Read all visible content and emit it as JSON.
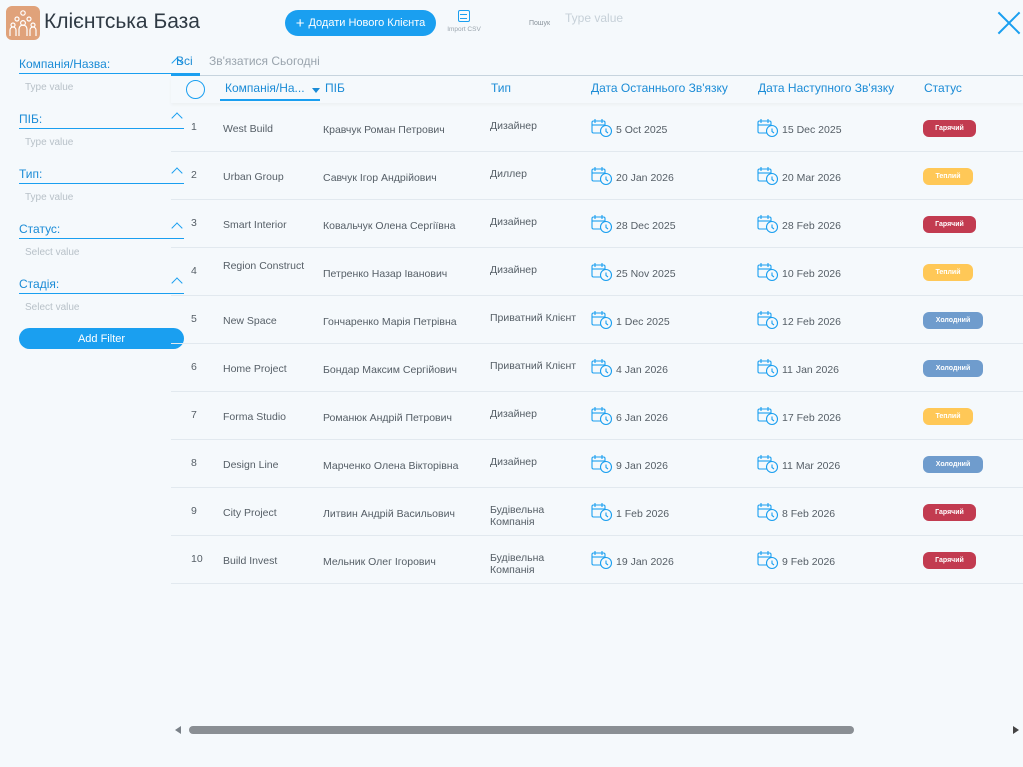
{
  "app": {
    "title": "Клієнтська База"
  },
  "toolbar": {
    "add_label": "Додати Нового Клієнта",
    "import_label": "Import CSV",
    "search_label": "Пошук",
    "search_placeholder": "Type value"
  },
  "filters": [
    {
      "label": "Компанія/Назва:",
      "placeholder": "Type value"
    },
    {
      "label": "ПІБ:",
      "placeholder": "Type value"
    },
    {
      "label": "Тип:",
      "placeholder": "Type value"
    },
    {
      "label": "Статус:",
      "placeholder": "Select value"
    },
    {
      "label": "Стадія:",
      "placeholder": "Select value"
    }
  ],
  "add_filter_label": "Add Filter",
  "tabs": {
    "all": "Всі",
    "today": "Зв'язатися Сьогодні"
  },
  "columns": {
    "company": "Компанія/На...",
    "name": "ПІБ",
    "type": "Тип",
    "last_contact": "Дата Останнього Зв'язку",
    "next_contact": "Дата Наступного Зв'язку",
    "status": "Статус"
  },
  "status_colors": {
    "Гарячий": "#c23b50",
    "Теплий": "#ffc857",
    "Холодний": "#6f9ccd"
  },
  "rows": [
    {
      "n": "1",
      "company": "West Build",
      "name": "Кравчук Роман Петрович",
      "type": "Дизайнер",
      "last": "5 Oct 2025",
      "next": "15 Dec 2025",
      "status": "Гарячий",
      "cls": "hot"
    },
    {
      "n": "2",
      "company": "Urban Group",
      "name": "Савчук Ігор Андрійович",
      "type": "Диллер",
      "last": "20 Jan 2026",
      "next": "20 Mar 2026",
      "status": "Теплий",
      "cls": "warm"
    },
    {
      "n": "3",
      "company": "Smart Interior",
      "name": "Ковальчук Олена Сергіївна",
      "type": "Дизайнер",
      "last": "28 Dec 2025",
      "next": "28 Feb 2026",
      "status": "Гарячий",
      "cls": "hot"
    },
    {
      "n": "4",
      "company": "Region Construct",
      "name": "Петренко Назар Іванович",
      "type": "Дизайнер",
      "last": "25 Nov 2025",
      "next": "10 Feb 2026",
      "status": "Теплий",
      "cls": "warm"
    },
    {
      "n": "5",
      "company": "New Space",
      "name": "Гончаренко Марія Петрівна",
      "type": "Приватний Клієнт",
      "last": "1 Dec 2025",
      "next": "12 Feb 2026",
      "status": "Холодний",
      "cls": "cold"
    },
    {
      "n": "6",
      "company": "Home Project",
      "name": "Бондар Максим Сергійович",
      "type": "Приватний Клієнт",
      "last": "4 Jan 2026",
      "next": "11 Jan 2026",
      "status": "Холодний",
      "cls": "cold"
    },
    {
      "n": "7",
      "company": "Forma Studio",
      "name": "Романюк Андрій Петрович",
      "type": "Дизайнер",
      "last": "6 Jan 2026",
      "next": "17 Feb 2026",
      "status": "Теплий",
      "cls": "warm"
    },
    {
      "n": "8",
      "company": "Design Line",
      "name": "Марченко Олена Вікторівна",
      "type": "Дизайнер",
      "last": "9 Jan 2026",
      "next": "11 Mar 2026",
      "status": "Холодний",
      "cls": "cold"
    },
    {
      "n": "9",
      "company": "City Project",
      "name": "Литвин Андрій Васильович",
      "type": "Будівельна Компанія",
      "last": "1 Feb 2026",
      "next": "8 Feb 2026",
      "status": "Гарячий",
      "cls": "hot"
    },
    {
      "n": "10",
      "company": "Build Invest",
      "name": "Мельник Олег Ігорович",
      "type": "Будівельна Компанія",
      "last": "19 Jan 2026",
      "next": "9 Feb 2026",
      "status": "Гарячий",
      "cls": "hot"
    }
  ]
}
